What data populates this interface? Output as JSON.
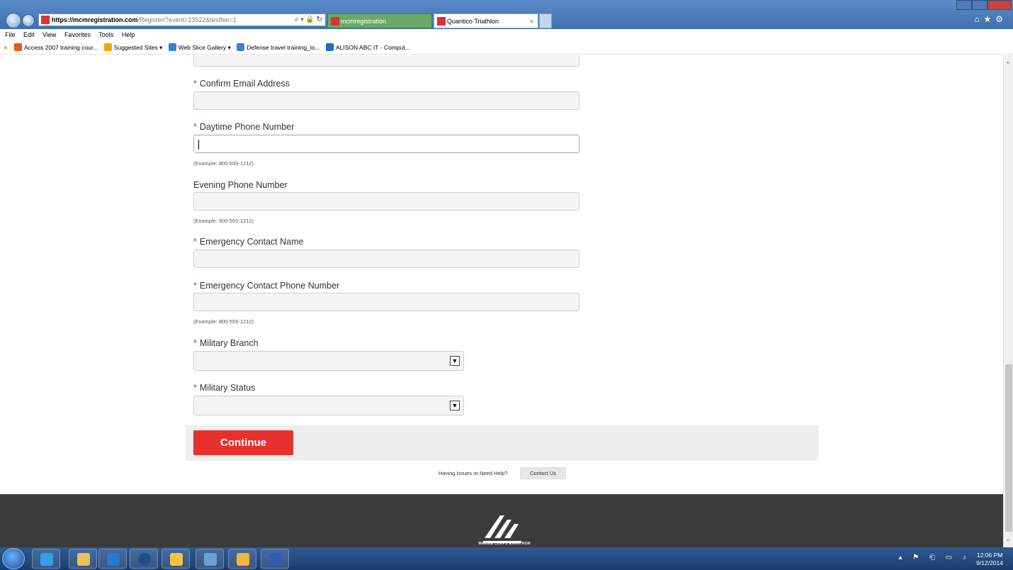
{
  "browser": {
    "address": {
      "domain": "https://mcmregistration.com",
      "path": "/Register/?event=23922&testfee=1",
      "icons": "⌕ ▾ 🔒 ↻"
    },
    "tabs": [
      {
        "label": "mcmregistration"
      },
      {
        "label": "Quantico Triathlon",
        "close": "×"
      }
    ],
    "right_icons": "⌂★⚙",
    "menu": [
      "File",
      "Edit",
      "View",
      "Favorites",
      "Tools",
      "Help"
    ],
    "favorites": [
      {
        "label": "Access 2007 training cour...",
        "color": "#e65c00"
      },
      {
        "label": "Suggested Sites ▾",
        "color": "#f2a900"
      },
      {
        "label": "Web Slice Gallery ▾",
        "color": "#3b7dd8"
      },
      {
        "label": "Defense travel training_lo...",
        "color": "#3b7dd8"
      },
      {
        "label": "ALISON ABC IT - Comput...",
        "color": "#1a6fb8"
      }
    ]
  },
  "form": {
    "required_mark": "*",
    "confirm_email_label": "Confirm Email Address",
    "daytime_phone_label": "Daytime Phone Number",
    "daytime_phone_hint": "(Example: 800-555-1212)",
    "evening_phone_label": "Evening Phone Number",
    "evening_phone_hint": "(Example: 800-555-1212)",
    "emergency_name_label": "Emergency Contact Name",
    "emergency_phone_label": "Emergency Contact Phone Number",
    "emergency_phone_hint": "(Example: 800-555-1212)",
    "military_branch_label": "Military Branch",
    "military_status_label": "Military Status",
    "dropdown_arrow": "▼",
    "continue_label": "Continue"
  },
  "help": {
    "text": "Having Issues or Need Help?",
    "contact_label": "Contact Us"
  },
  "footer": {
    "logo_text": "MARINE CORPS MARATHON"
  },
  "taskbar": {
    "clock_time": "12:06 PM",
    "clock_date": "9/12/2014",
    "tray_icons": "▴ ⚑ ⎗ ▭ ♪"
  },
  "colors": {
    "accent": "#e8312c",
    "footer_bg": "#3b3b3b"
  }
}
